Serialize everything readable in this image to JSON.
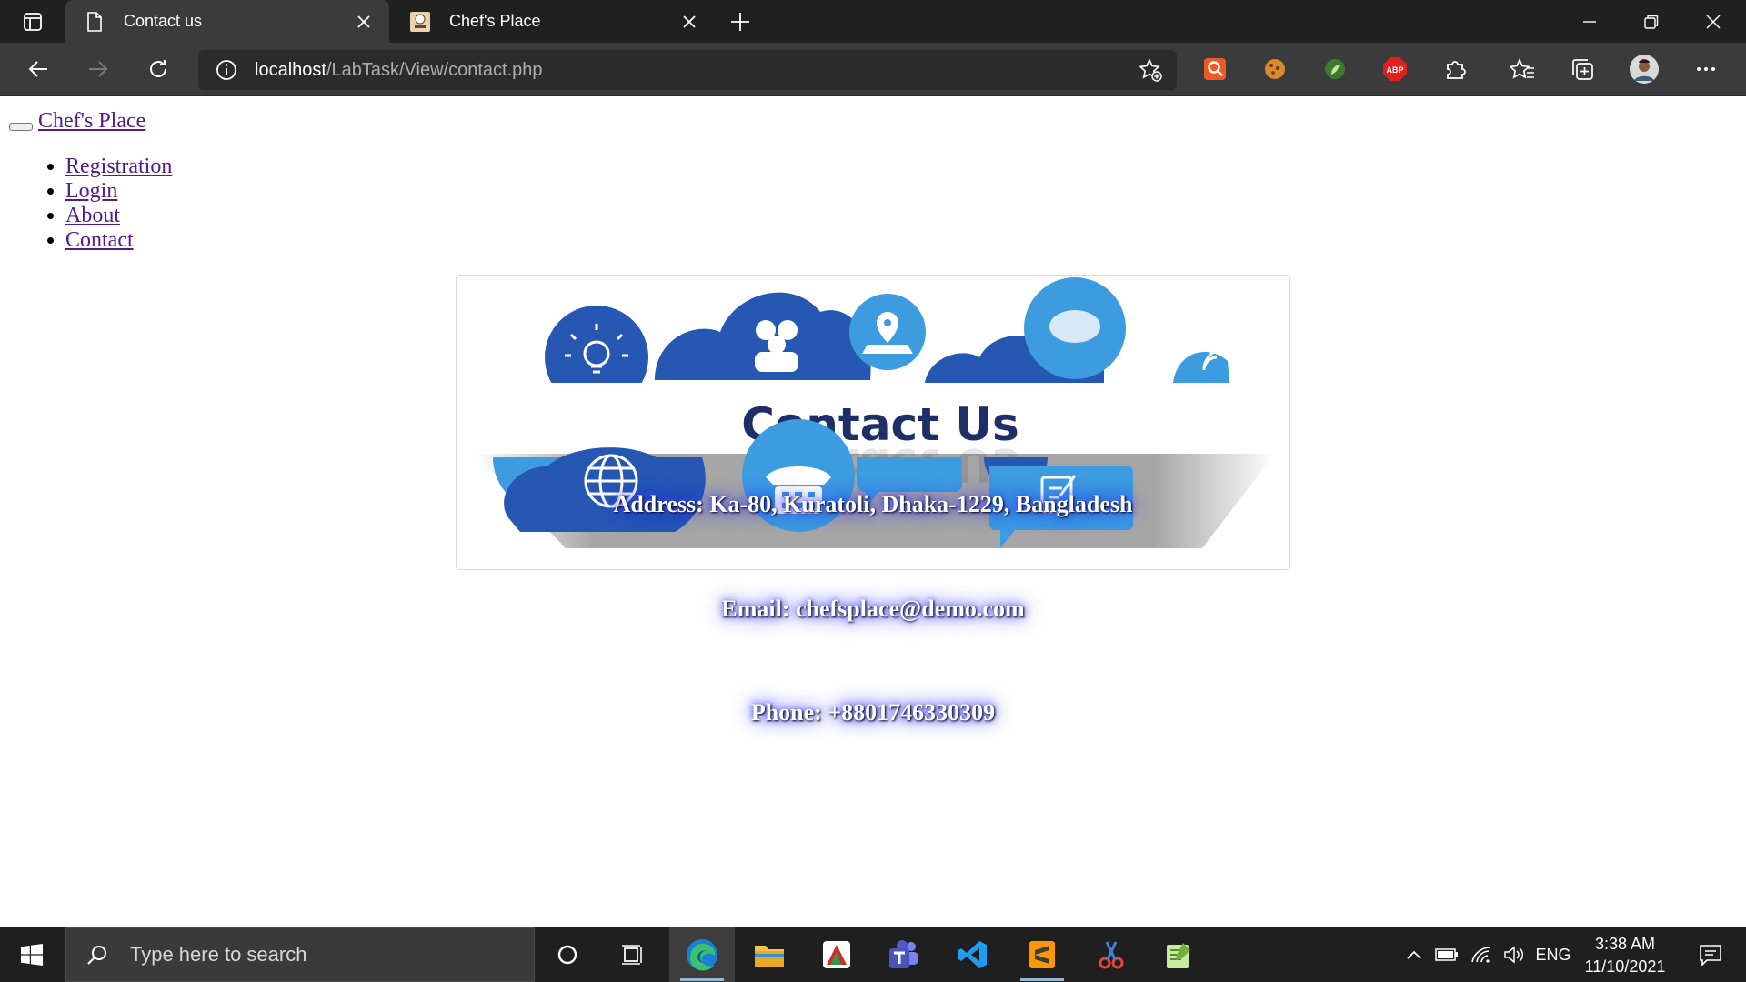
{
  "browser": {
    "tabs": [
      {
        "title": "Contact us",
        "icon": "page-icon",
        "active": true
      },
      {
        "title": "Chef's Place",
        "icon": "chef-favicon-icon",
        "active": false
      }
    ],
    "address": {
      "host": "localhost",
      "path": "/LabTask/View/contact.php"
    },
    "extensions": [
      "search-extension-icon",
      "cookie-extension-icon",
      "green-leaf-extension-icon",
      "adblock-plus-icon",
      "extensions-puzzle-icon"
    ],
    "adblock_label": "ABP"
  },
  "page": {
    "brand": "Chef's Place",
    "menu": [
      "Registration",
      "Login",
      "About",
      "Contact"
    ],
    "banner_title": "Contact Us",
    "address_line": "Address: Ka-80, Kuratoli, Dhaka-1229, Bangladesh",
    "email_line": "Email: chefsplace@demo.com",
    "phone_line": "Phone: +8801746330309"
  },
  "taskbar": {
    "search_placeholder": "Type here to search",
    "language": "ENG",
    "time": "3:38 AM",
    "date": "11/10/2021"
  },
  "colors": {
    "banner_dark_blue": "#2657b3",
    "banner_light_blue": "#3d9be0",
    "banner_text": "#1d2f66",
    "link": "#551a8b",
    "info_glow": "#1e1ef0"
  }
}
